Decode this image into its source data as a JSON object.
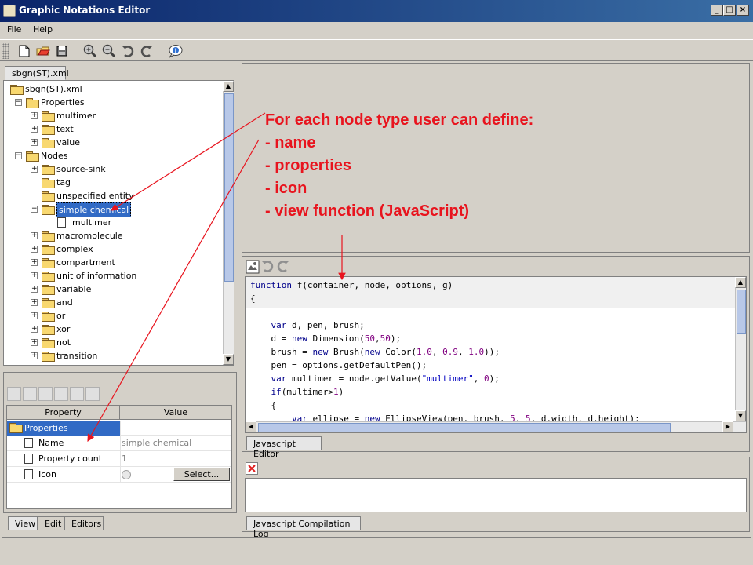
{
  "window": {
    "title": "Graphic Notations Editor"
  },
  "menu": [
    "File",
    "Help"
  ],
  "toolbar": {
    "buttons": [
      "new-icon",
      "open-icon",
      "save-icon",
      "zoom-in-icon",
      "zoom-out-icon",
      "undo-icon",
      "redo-icon",
      "info-icon"
    ]
  },
  "file_tab": "sbgn(ST).xml",
  "tree": [
    {
      "label": "sbgn(ST).xml",
      "depth": 0,
      "type": "folder",
      "exp": ""
    },
    {
      "label": "Properties",
      "depth": 1,
      "type": "folder-open",
      "exp": "-"
    },
    {
      "label": "multimer",
      "depth": 2,
      "type": "folder",
      "exp": "+"
    },
    {
      "label": "text",
      "depth": 2,
      "type": "folder",
      "exp": "+"
    },
    {
      "label": "value",
      "depth": 2,
      "type": "folder",
      "exp": "+"
    },
    {
      "label": "Nodes",
      "depth": 1,
      "type": "folder-open",
      "exp": "-"
    },
    {
      "label": "source-sink",
      "depth": 2,
      "type": "folder",
      "exp": "+"
    },
    {
      "label": "tag",
      "depth": 2,
      "type": "folder-open",
      "exp": ""
    },
    {
      "label": "unspecified entity",
      "depth": 2,
      "type": "folder-open",
      "exp": ""
    },
    {
      "label": "simple chemical",
      "depth": 2,
      "type": "folder-open",
      "exp": "-",
      "selected": true
    },
    {
      "label": "multimer",
      "depth": 3,
      "type": "doc",
      "exp": ""
    },
    {
      "label": "macromolecule",
      "depth": 2,
      "type": "folder",
      "exp": "+"
    },
    {
      "label": "complex",
      "depth": 2,
      "type": "folder",
      "exp": "+"
    },
    {
      "label": "compartment",
      "depth": 2,
      "type": "folder",
      "exp": "+"
    },
    {
      "label": "unit of information",
      "depth": 2,
      "type": "folder",
      "exp": "+"
    },
    {
      "label": "variable",
      "depth": 2,
      "type": "folder",
      "exp": "+"
    },
    {
      "label": "and",
      "depth": 2,
      "type": "folder",
      "exp": "+"
    },
    {
      "label": "or",
      "depth": 2,
      "type": "folder",
      "exp": "+"
    },
    {
      "label": "xor",
      "depth": 2,
      "type": "folder",
      "exp": "+"
    },
    {
      "label": "not",
      "depth": 2,
      "type": "folder",
      "exp": "+"
    },
    {
      "label": "transition",
      "depth": 2,
      "type": "folder",
      "exp": "+"
    }
  ],
  "properties": {
    "col_property": "Property",
    "col_value": "Value",
    "group": "Properties",
    "rows": [
      {
        "name": "Name",
        "value": "simple chemical"
      },
      {
        "name": "Property count",
        "value": "1"
      },
      {
        "name": "Icon",
        "value": "",
        "button": "Select..."
      }
    ]
  },
  "bottom_tabs": [
    "View",
    "Edit",
    "Editors"
  ],
  "annotation": {
    "lines": [
      "For each node type user can define:",
      "- name",
      "- properties",
      "- icon",
      "- view function (JavaScript)"
    ]
  },
  "code": [
    "function f(container, node, options, g)",
    "{",
    "",
    "    var d, pen, brush;",
    "    d = new Dimension(50,50);",
    "    brush = new Brush(new Color(1.0, 0.9, 1.0));",
    "    pen = options.getDefaultPen();",
    "    var multimer = node.getValue(\"multimer\", 0);",
    "    if(multimer>1)",
    "    {",
    "        var ellipse = new EllipseView(pen, brush, 5, 5, d.width, d.height);"
  ],
  "editor_tab": "Javascript Editor",
  "log_tab": "Javascript Compilation Log",
  "colors": {
    "annotation": "#e8141e",
    "selection": "#316ac5",
    "titlebar": "#0a246a"
  }
}
